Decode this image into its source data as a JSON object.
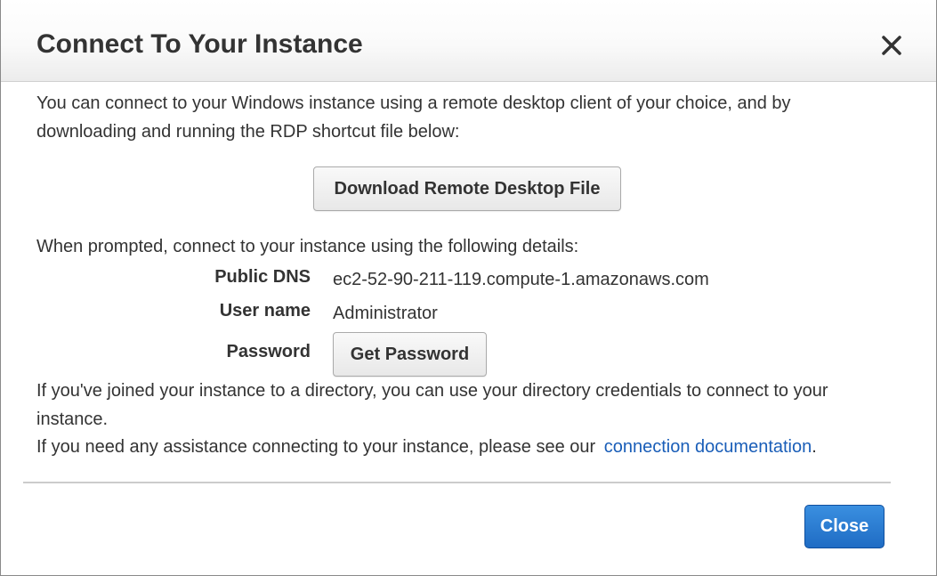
{
  "dialog": {
    "title": "Connect To Your Instance",
    "close_icon": "close-icon"
  },
  "intro": {
    "text": "You can connect to your Windows instance using a remote desktop client of your choice, and by downloading and running the RDP shortcut file below:"
  },
  "download_button": {
    "label": "Download Remote Desktop File"
  },
  "prompt": {
    "text": "When prompted, connect to your instance using the following details:"
  },
  "details": {
    "public_dns": {
      "label": "Public DNS",
      "value": "ec2-52-90-211-119.compute-1.amazonaws.com"
    },
    "user_name": {
      "label": "User name",
      "value": "Administrator"
    },
    "password": {
      "label": "Password",
      "button_label": "Get Password"
    }
  },
  "directory_note": {
    "text": "If you've joined your instance to a directory, you can use your directory credentials to connect to your instance."
  },
  "assistance": {
    "text": "If you need any assistance connecting to your instance, please see our",
    "link_label": "connection documentation",
    "suffix": "."
  },
  "footer": {
    "close_label": "Close"
  },
  "colors": {
    "link": "#1a5eb8",
    "primary_button": "#1f6cc4",
    "text": "#333333"
  }
}
